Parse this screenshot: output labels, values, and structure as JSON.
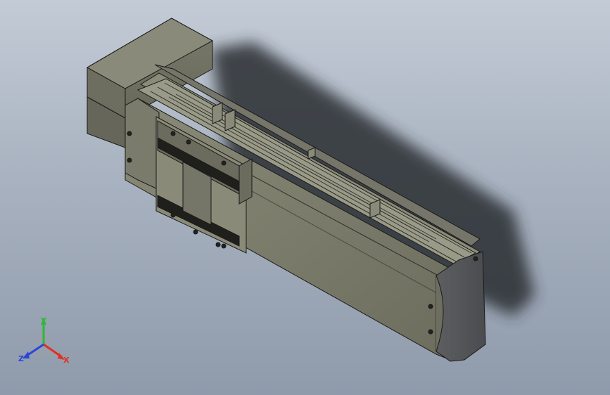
{
  "viewport": {
    "background_top": "#c3cbd6",
    "background_bottom": "#8f9aab",
    "model_color": "#7c7c6c",
    "model_edge_color": "#1a1a18"
  },
  "triad": {
    "x_label": "X",
    "y_label": "Y",
    "z_label": "Z",
    "x_color": "#e03020",
    "y_color": "#2db83a",
    "z_color": "#2a46d8"
  }
}
